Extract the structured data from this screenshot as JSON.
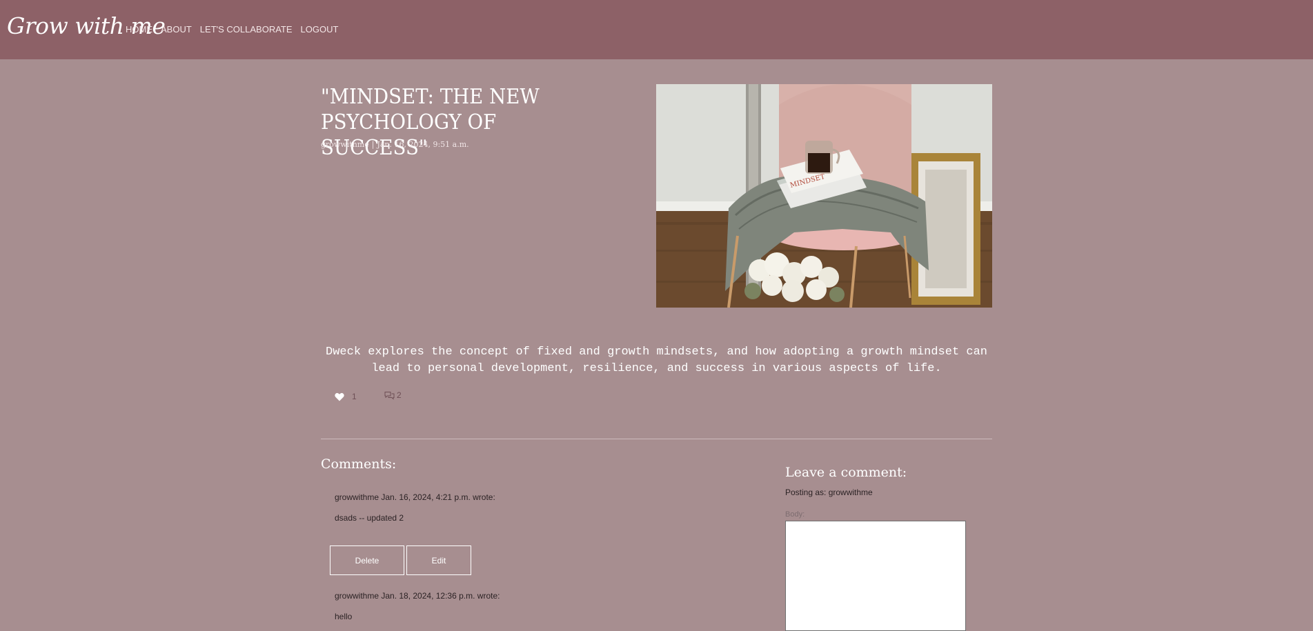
{
  "nav": {
    "brand": "Grow with me",
    "links": [
      "HOME",
      "ABOUT",
      "LET'S COLLABORATE",
      "LOGOUT"
    ]
  },
  "post": {
    "title": "\"MINDSET: THE NEW PSYCHOLOGY OF SUCCESS\"",
    "author": "growwithme",
    "separator": "|",
    "date": "Jan. 16, 2024, 9:51 a.m.",
    "excerpt": "Dweck explores the concept of fixed and growth mindsets, and how adopting a growth mindset can lead to personal development, resilience, and success in various aspects of life.",
    "likes": "1",
    "comment_count": "2",
    "image_icon": "chair-with-books-and-coffee-photo"
  },
  "comments": {
    "heading": "Comments:",
    "items": [
      {
        "author_line": "growwithme Jan. 16, 2024, 4:21 p.m. wrote:",
        "body": "dsads -- updated 2"
      },
      {
        "author_line": "growwithme Jan. 18, 2024, 12:36 p.m. wrote:",
        "body": "hello"
      }
    ],
    "delete_label": "Delete",
    "edit_label": "Edit"
  },
  "form": {
    "heading": "Leave a comment:",
    "posting_as": "Posting as: growwithme",
    "body_label": "Body:",
    "body_value": ""
  },
  "colors": {
    "navbar": "#8d6167",
    "background": "#a78e90",
    "divider": "#cdbcbe"
  }
}
